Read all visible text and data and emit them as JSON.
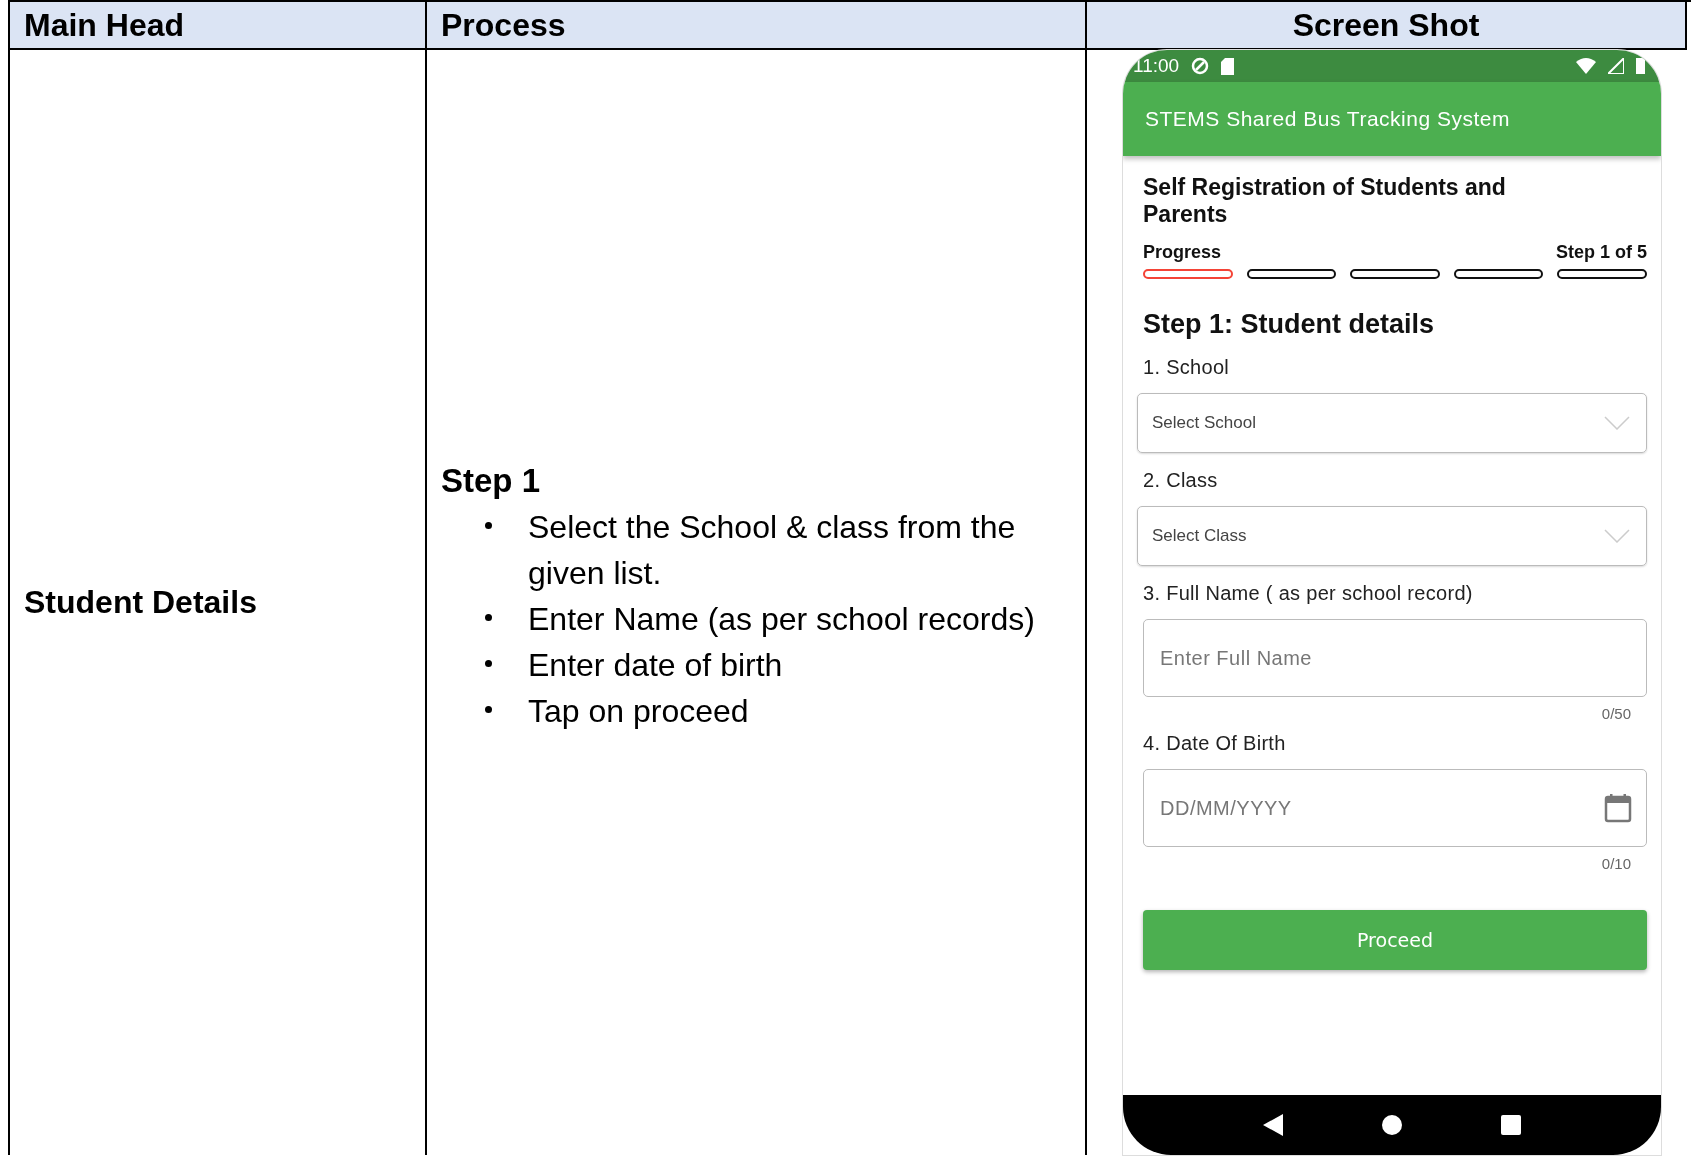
{
  "table": {
    "columns": [
      "Main Head",
      "Process",
      "Screen Shot"
    ],
    "rows": [
      {
        "main_head": "Student Details",
        "process": {
          "heading": "Step 1",
          "bullets": [
            "Select the School & class from the given list.",
            "Enter Name (as per school records)",
            "Enter date of birth",
            "Tap on proceed"
          ]
        }
      }
    ]
  },
  "phone": {
    "status_bar": {
      "time": "11:00"
    },
    "app_bar": {
      "title": "STEMS Shared Bus Tracking System"
    },
    "page_title": "Self Registration of Students and Parents",
    "progress": {
      "label": "Progress",
      "step_text": "Step 1 of 5",
      "segments": [
        {
          "active": true
        },
        {
          "active": false
        },
        {
          "active": false
        },
        {
          "active": false
        },
        {
          "active": false
        }
      ]
    },
    "section_title": "Step 1: Student details",
    "fields": [
      {
        "kind": "select",
        "label": "1. School",
        "placeholder": "Select School"
      },
      {
        "kind": "select",
        "label": "2. Class",
        "placeholder": "Select Class"
      },
      {
        "kind": "text",
        "label": "3. Full Name ( as per school record)",
        "placeholder": "Enter Full Name",
        "counter": "0/50"
      },
      {
        "kind": "date",
        "label": "4. Date Of Birth",
        "placeholder": "DD/MM/YYYY",
        "counter": "0/10"
      }
    ],
    "button": "Proceed"
  }
}
